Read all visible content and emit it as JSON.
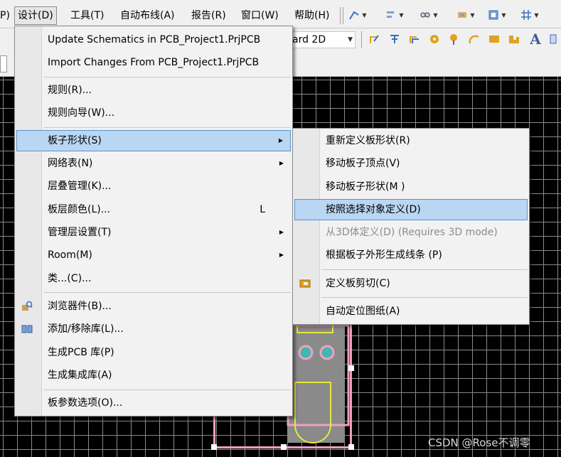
{
  "menubar": {
    "items": [
      {
        "label": "P)"
      },
      {
        "label": "设计(D)"
      },
      {
        "label": "工具(T)"
      },
      {
        "label": "自动布线(A)"
      },
      {
        "label": "报告(R)"
      },
      {
        "label": "窗口(W)"
      },
      {
        "label": "帮助(H)"
      }
    ]
  },
  "toolbar": {
    "view_mode": "ard 2D"
  },
  "design_menu": {
    "items": [
      {
        "label": "Update Schematics in PCB_Project1.PrjPCB"
      },
      {
        "label": "Import Changes From PCB_Project1.PrjPCB"
      },
      {
        "label": "规则(R)..."
      },
      {
        "label": "规则向导(W)..."
      },
      {
        "label": "板子形状(S)"
      },
      {
        "label": "网络表(N)"
      },
      {
        "label": "层叠管理(K)..."
      },
      {
        "label": "板层颜色(L)...",
        "shortcut": "L"
      },
      {
        "label": "管理层设置(T)"
      },
      {
        "label": "Room(M)"
      },
      {
        "label": "类...(C)..."
      },
      {
        "label": "浏览器件(B)..."
      },
      {
        "label": "添加/移除库(L)..."
      },
      {
        "label": "生成PCB 库(P)"
      },
      {
        "label": "生成集成库(A)"
      },
      {
        "label": "板参数选项(O)..."
      }
    ]
  },
  "board_shape_submenu": {
    "items": [
      {
        "label": "重新定义板形状(R)"
      },
      {
        "label": "移动板子顶点(V)"
      },
      {
        "label": "移动板子形状(M )"
      },
      {
        "label": "按照选择对象定义(D)"
      },
      {
        "label": "从3D体定义(D) (Requires 3D mode)"
      },
      {
        "label": "根据板子外形生成线条 (P)"
      },
      {
        "label": "定义板剪切(C)"
      },
      {
        "label": "自动定位图纸(A)"
      }
    ]
  },
  "watermark": "CSDN @Rose不调零",
  "colors": {
    "highlight": "#b9d6f2",
    "board_outline": "#f0a0c0",
    "silkscreen": "#e8e840",
    "pad": "#40b8b0"
  }
}
